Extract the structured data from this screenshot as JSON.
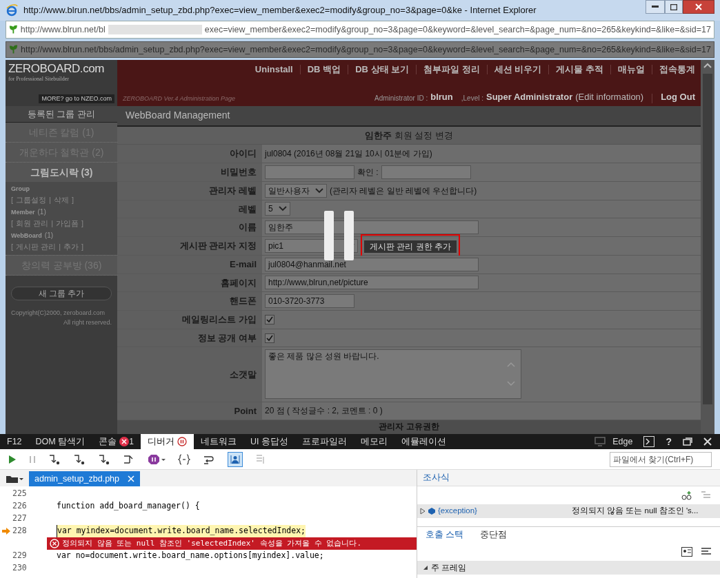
{
  "window": {
    "title": "http://www.blrun.net/bbs/admin_setup_zbd.php?exec=view_member&exec2=modify&group_no=3&page=0&ke - Internet Explorer"
  },
  "address_bar": {
    "url_start": "http://www.blrun.net/bl",
    "url_end": "exec=view_member&exec2=modify&group_no=3&page=0&keyword=&level_search=&page_num=&no=265&keykind=&like=&sid=17"
  },
  "address_bar_2": {
    "url": "http://www.blrun.net/bbs/admin_setup_zbd.php?exec=view_member&exec2=modify&group_no=3&page=0&keyword=&level_search=&page_num=&no=265&keykind=&like=&sid=17"
  },
  "admin": {
    "logo": "ZEROBOARD.com",
    "logo_sub": "for Professional Sitebuilder",
    "more": "MORE? go to NZEO.com",
    "version": "ZEROBOARD Ver.4 Administration Page",
    "menu": [
      "Uninstall",
      "DB 백업",
      "DB 상태 보기",
      "첨부파일 정리",
      "세션 비우기",
      "게시물 추적",
      "매뉴얼",
      "접속통계"
    ],
    "admin_id_label": "Administrator ID :",
    "admin_id": "blrun",
    "level_label": ",Level :",
    "level": "Super Administrator",
    "edit": "(Edit information)",
    "logout": "Log Out"
  },
  "sidebar": {
    "title": "등록된 그룹 관리",
    "groups": [
      {
        "label": "네티즌 칼럼 (1)",
        "selected": false
      },
      {
        "label": "개운하다 철학관 (2)",
        "selected": false
      },
      {
        "label": "그림도시락 (3)",
        "selected": true,
        "sections": [
          {
            "heading": "Group",
            "links": [
              "그룹설정",
              "삭제"
            ]
          },
          {
            "heading": "Member",
            "count": "(1)",
            "links": [
              "회원 관리",
              "가입폼"
            ]
          },
          {
            "heading": "WebBoard",
            "count": "(1)",
            "links": [
              "게시판 관리",
              "추가"
            ]
          }
        ]
      },
      {
        "label": "창의력 공부방 (36)",
        "selected": false
      }
    ],
    "bracket_open": "[",
    "bracket_close": "]",
    "separator": "|",
    "new_group": "새 그룹 추가",
    "copyright": [
      "Copyright(C)2000, zeroboard.com",
      "All right reserved."
    ]
  },
  "section_title": "WebBoard Management",
  "form": {
    "title_name": "임한주",
    "title_rest": "회원 설정 변경",
    "rows": [
      {
        "kind": "text",
        "label": "아이디",
        "value": "jul0804  (2016년 08월 21일 10시 01분에 가입)"
      },
      {
        "kind": "password",
        "label": "비밀번호",
        "confirm_label": "확인 :"
      },
      {
        "kind": "select",
        "label": "관리자 레벨",
        "value": "일반사용자",
        "note": "(관리자 레벨은 일반 레벨에 우선합니다)"
      },
      {
        "kind": "select",
        "label": "레벨",
        "value": "5"
      },
      {
        "kind": "input",
        "label": "이름",
        "value": "임한주"
      },
      {
        "kind": "select",
        "label": "게시판 관리자 지정",
        "value": "pic1",
        "button": "게시판 관리 권한 추가",
        "highlighted": true
      },
      {
        "kind": "input",
        "label": "E-mail",
        "value": "jul0804@hanmail.net"
      },
      {
        "kind": "input",
        "label": "홈페이지",
        "value": "http://www,blrun,net/picture"
      },
      {
        "kind": "input",
        "label": "핸드폰",
        "value": "010-3720-3773"
      },
      {
        "kind": "checkbox",
        "label": "메일링리스트 가입",
        "checked": true
      },
      {
        "kind": "checkbox",
        "label": "정보 공개 여부",
        "checked": true
      },
      {
        "kind": "textarea",
        "label": "소갯말",
        "value": "좋은 제품 많은 성원 바랍니다."
      },
      {
        "kind": "text",
        "label": "Point",
        "value": "20 점 ( 작성글수 : 2, 코멘트 : 0 )"
      }
    ],
    "next_heading": "관리자 고유권한"
  },
  "devtools": {
    "tabs": [
      {
        "label": "F12",
        "selected": false
      },
      {
        "label": "DOM 탐색기",
        "selected": false
      },
      {
        "label": "콘솔",
        "selected": false,
        "badge": "1"
      },
      {
        "label": "디버거",
        "selected": true,
        "paused": true
      },
      {
        "label": "네트워크",
        "selected": false
      },
      {
        "label": "UI 응답성",
        "selected": false
      },
      {
        "label": "프로파일러",
        "selected": false
      },
      {
        "label": "메모리",
        "selected": false
      },
      {
        "label": "에뮬레이션",
        "selected": false
      }
    ],
    "mode": "Edge",
    "help": "?",
    "search": {
      "placeholder": "파일에서 찾기(Ctrl+F)"
    },
    "file_tab": "admin_setup_zbd.php",
    "lines": [
      {
        "number": "225",
        "current": false
      },
      {
        "number": "226",
        "code": "function add_board_manager() {",
        "current": false
      },
      {
        "number": "227",
        "current": false
      },
      {
        "number": "228",
        "code": "var myindex=document.write.board_name.selectedIndex;",
        "current": true,
        "error": "정의되지 않음 또는 null 참조인 'selectedIndex' 속성을 가져올 수 없습니다."
      },
      {
        "number": "229",
        "code": "var no=document.write.board_name.options[myindex].value;",
        "current": false
      },
      {
        "number": "230",
        "current": false
      }
    ],
    "watch": {
      "title": "조사식",
      "name": "{exception}",
      "value": "정의되지 않음 또는 null 참조인 's..."
    },
    "bottom_tabs": [
      {
        "label": "호출 스택",
        "selected": true
      },
      {
        "label": "중단점",
        "selected": false
      }
    ],
    "frame": "주 프레임"
  }
}
